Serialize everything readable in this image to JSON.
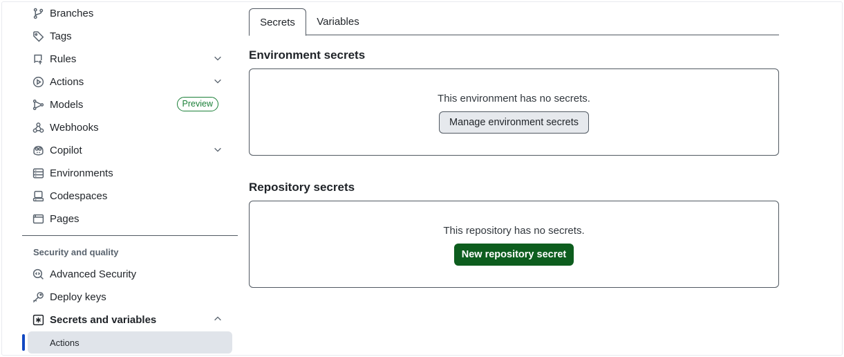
{
  "sidebar": {
    "items": [
      {
        "label": "Branches",
        "icon": "git-branch-icon"
      },
      {
        "label": "Tags",
        "icon": "tag-icon"
      },
      {
        "label": "Rules",
        "icon": "repo-push-icon"
      },
      {
        "label": "Actions",
        "icon": "play-icon"
      },
      {
        "label": "Models",
        "icon": "models-icon",
        "badge": "Preview"
      },
      {
        "label": "Webhooks",
        "icon": "webhook-icon"
      },
      {
        "label": "Copilot",
        "icon": "copilot-icon"
      },
      {
        "label": "Environments",
        "icon": "server-icon"
      },
      {
        "label": "Codespaces",
        "icon": "codespaces-icon"
      },
      {
        "label": "Pages",
        "icon": "browser-icon"
      }
    ],
    "section_heading": "Security and quality",
    "security_items": [
      {
        "label": "Advanced Security",
        "icon": "codescan-icon"
      },
      {
        "label": "Deploy keys",
        "icon": "key-icon"
      },
      {
        "label": "Secrets and variables",
        "icon": "asterisk-icon"
      }
    ],
    "sub_item": {
      "label": "Actions"
    }
  },
  "tabs": [
    {
      "label": "Secrets",
      "active": true
    },
    {
      "label": "Variables",
      "active": false
    }
  ],
  "environment_secrets": {
    "heading": "Environment secrets",
    "message": "This environment has no secrets.",
    "button": "Manage environment secrets"
  },
  "repository_secrets": {
    "heading": "Repository secrets",
    "message": "This repository has no secrets.",
    "button": "New repository secret"
  },
  "colors": {
    "primary_button": "#0d5d1e",
    "badge_green": "#1a7f37",
    "active_indicator": "#1148c2",
    "selected_bg": "#e0e4ea"
  }
}
